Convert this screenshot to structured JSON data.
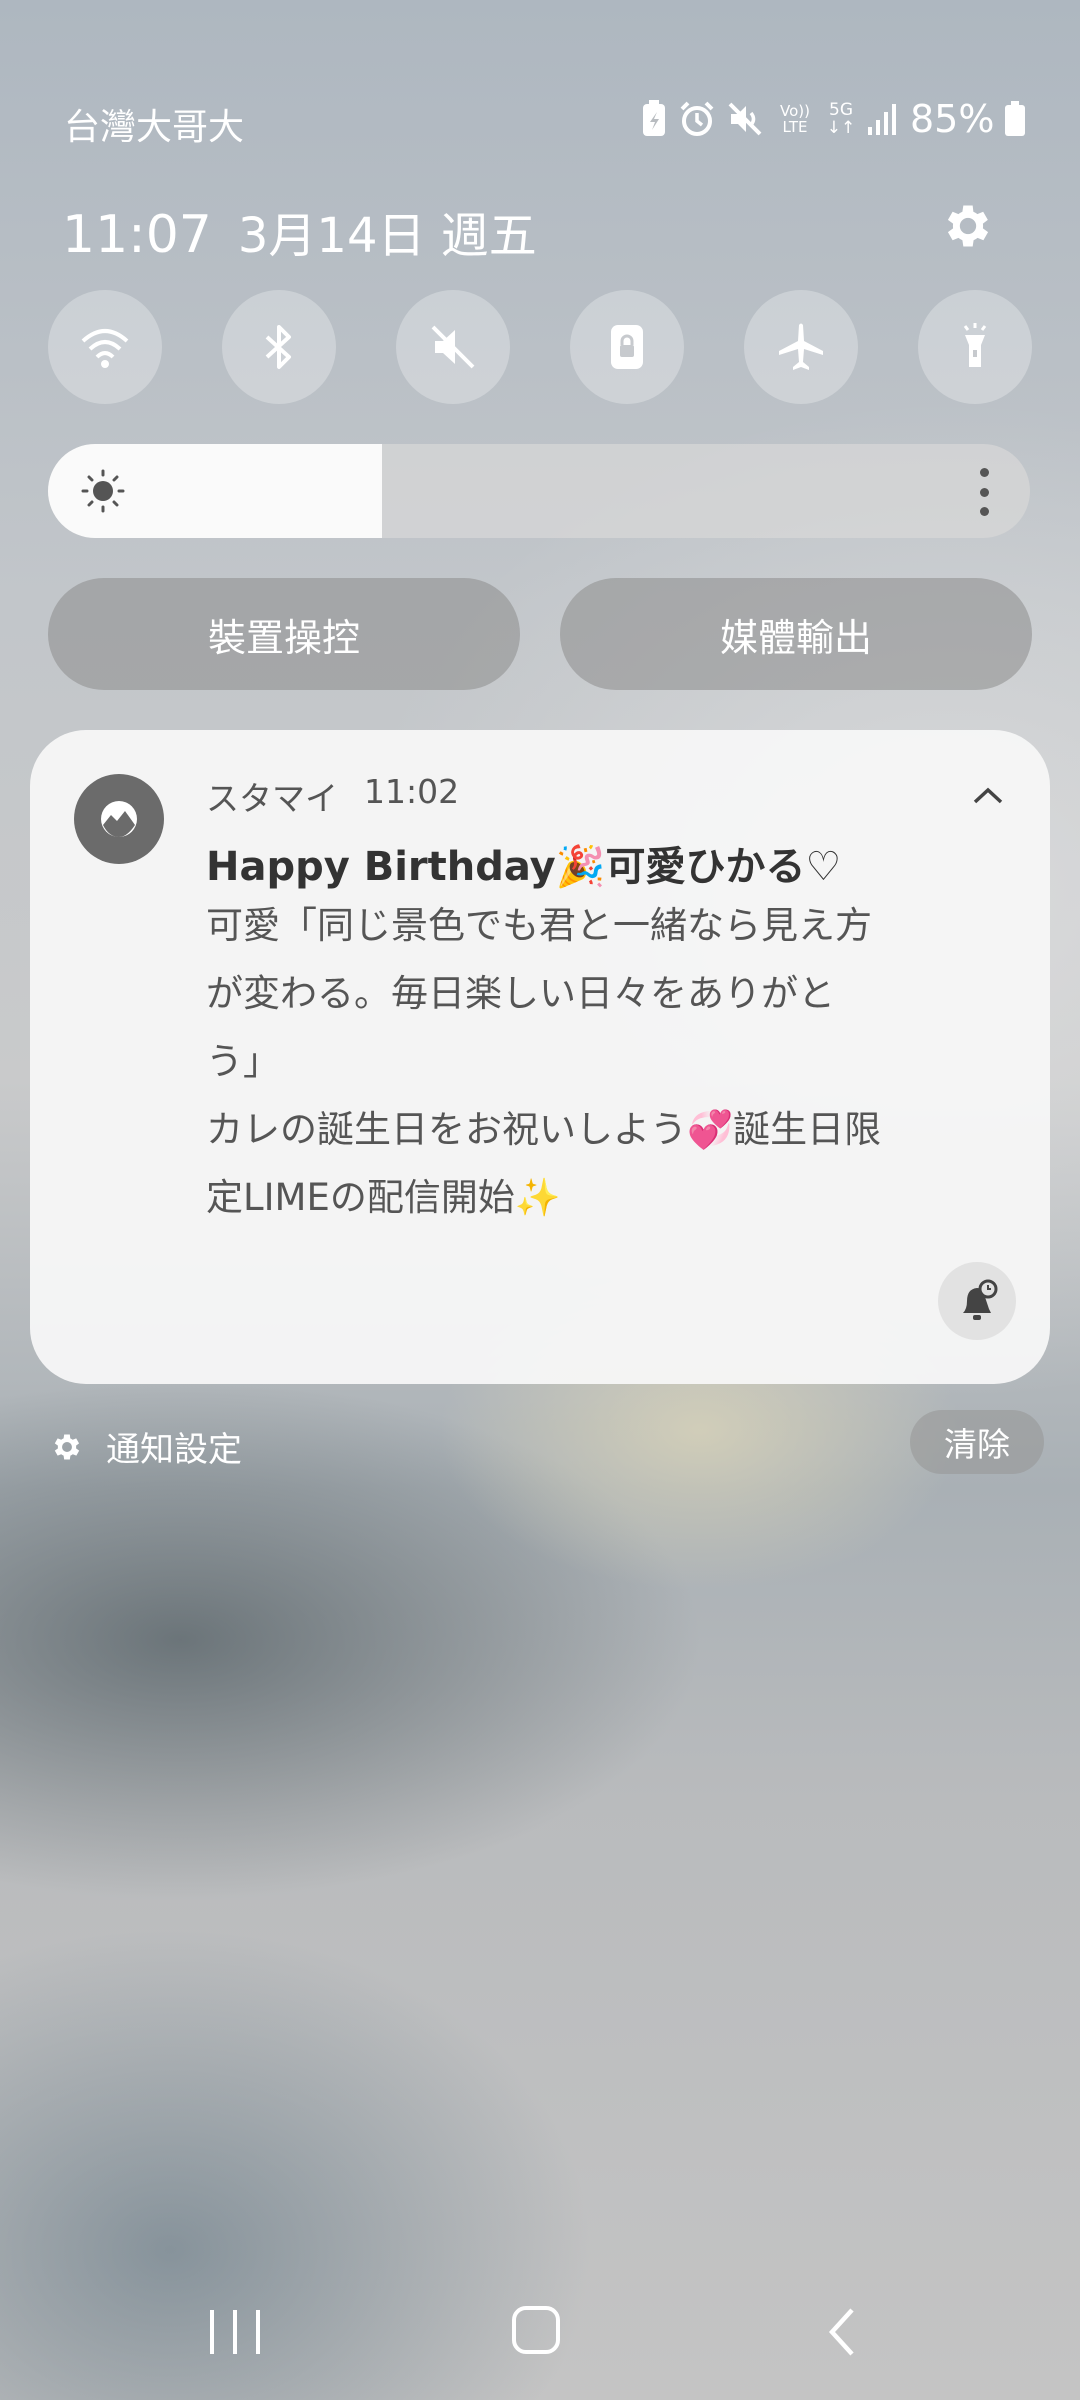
{
  "status_bar": {
    "carrier": "台灣大哥大",
    "battery": "85%",
    "icons": [
      "battery-saver-icon",
      "alarm-icon",
      "mute-icon",
      "volte-icon",
      "5g-icon",
      "signal-icon",
      "battery-icon"
    ],
    "volte_label_top": "Vo))",
    "volte_label_bottom": "LTE",
    "network": "5G"
  },
  "header": {
    "time": "11:07",
    "date": "3月14日 週五"
  },
  "quick_settings": [
    {
      "name": "wifi",
      "icon": "wifi-icon"
    },
    {
      "name": "bluetooth",
      "icon": "bluetooth-icon"
    },
    {
      "name": "sound",
      "icon": "mute-icon"
    },
    {
      "name": "rotation-lock",
      "icon": "lock-icon"
    },
    {
      "name": "airplane",
      "icon": "airplane-icon"
    },
    {
      "name": "flashlight",
      "icon": "flashlight-icon"
    }
  ],
  "brightness": {
    "level": 0.34
  },
  "buttons": {
    "device_control": "裝置操控",
    "media_output": "媒體輸出"
  },
  "notification": {
    "app_name": "スタマイ",
    "time": "11:02",
    "title": "Happy Birthday🎉可愛ひかる♡",
    "body_lines": [
      "可愛「同じ景色でも君と一緒なら見え方",
      "が変わる。毎日楽しい日々をありがと",
      "う」",
      "カレの誕生日をお祝いしよう💞誕生日限",
      "定LIMEの配信開始✨"
    ]
  },
  "footer": {
    "notification_settings": "通知設定",
    "clear": "清除"
  },
  "colors": {
    "card_bg": "#f6f6f6",
    "pill_bg": "#9a9a9a",
    "brightness_fill": "#fafafa"
  }
}
